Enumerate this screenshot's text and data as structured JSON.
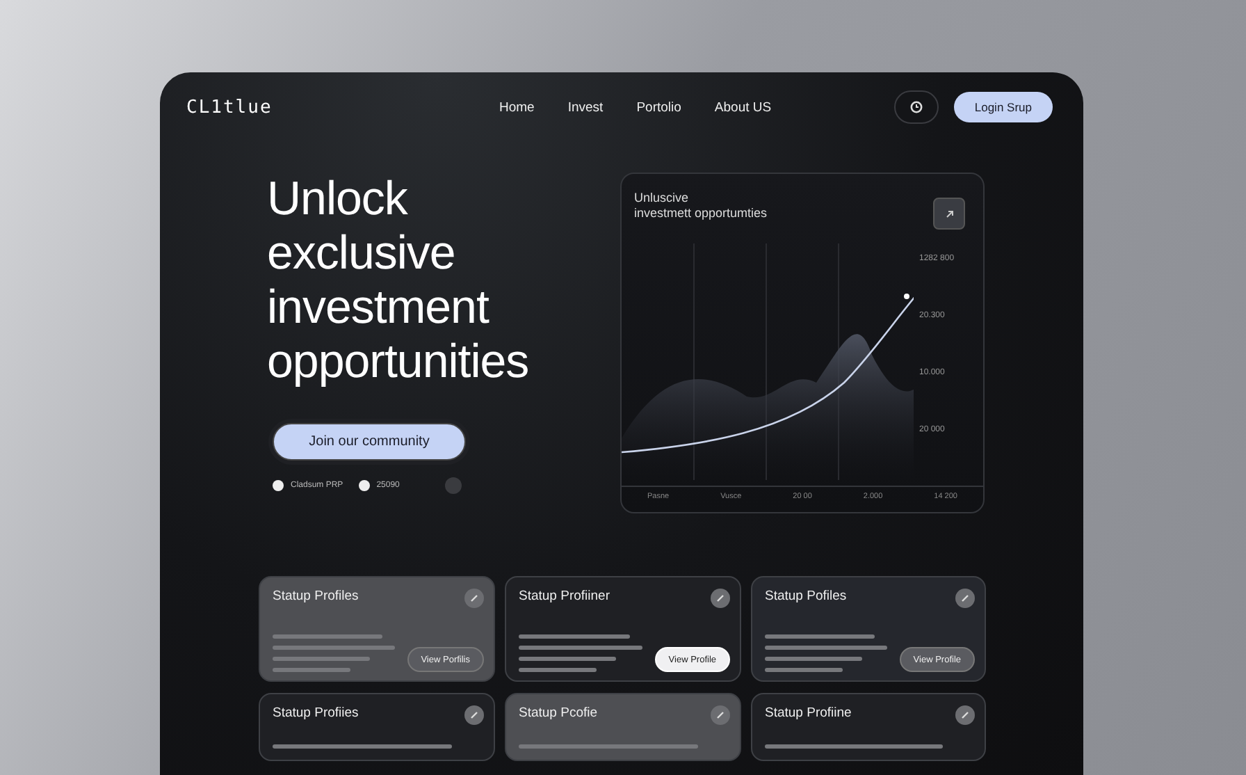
{
  "nav": {
    "logo": "CL1tlue",
    "links": [
      {
        "label": "Home"
      },
      {
        "label": "Invest"
      },
      {
        "label": "Portolio"
      },
      {
        "label": "About US"
      }
    ],
    "login": "Login Srup"
  },
  "hero": {
    "title": "Unlock exclusive investment opportunities",
    "cta": "Join our community",
    "stats": [
      {
        "text": "Cladsum PRP"
      },
      {
        "text": "25090"
      }
    ]
  },
  "chart_card": {
    "title_lines": [
      "Unluscive",
      "investmett opportumties"
    ],
    "y_labels": [
      "1282 800",
      "20.300",
      "10.000",
      "20 000"
    ],
    "x_labels": [
      "Pasne",
      "Vusce",
      "20 00",
      "2.000",
      "14 200"
    ]
  },
  "cards": [
    {
      "title": "Statup Profiles",
      "color": "#4e4f53",
      "button": {
        "label": "View Porfilis",
        "highlighted": false
      }
    },
    {
      "title": "Statup Profiiner",
      "color": "#1f2024",
      "button": {
        "label": "View Profile",
        "highlighted": true
      }
    },
    {
      "title": "Statup Pofiles",
      "color": "#25272d",
      "button": {
        "label": "View Profile",
        "highlighted": false
      }
    },
    {
      "title": "Statup Profiies",
      "color": "#1f2024"
    },
    {
      "title": "Statup Pcofie",
      "color": "#4e4f53"
    },
    {
      "title": "Statup Profiine",
      "color": "#1f2024"
    }
  ]
}
